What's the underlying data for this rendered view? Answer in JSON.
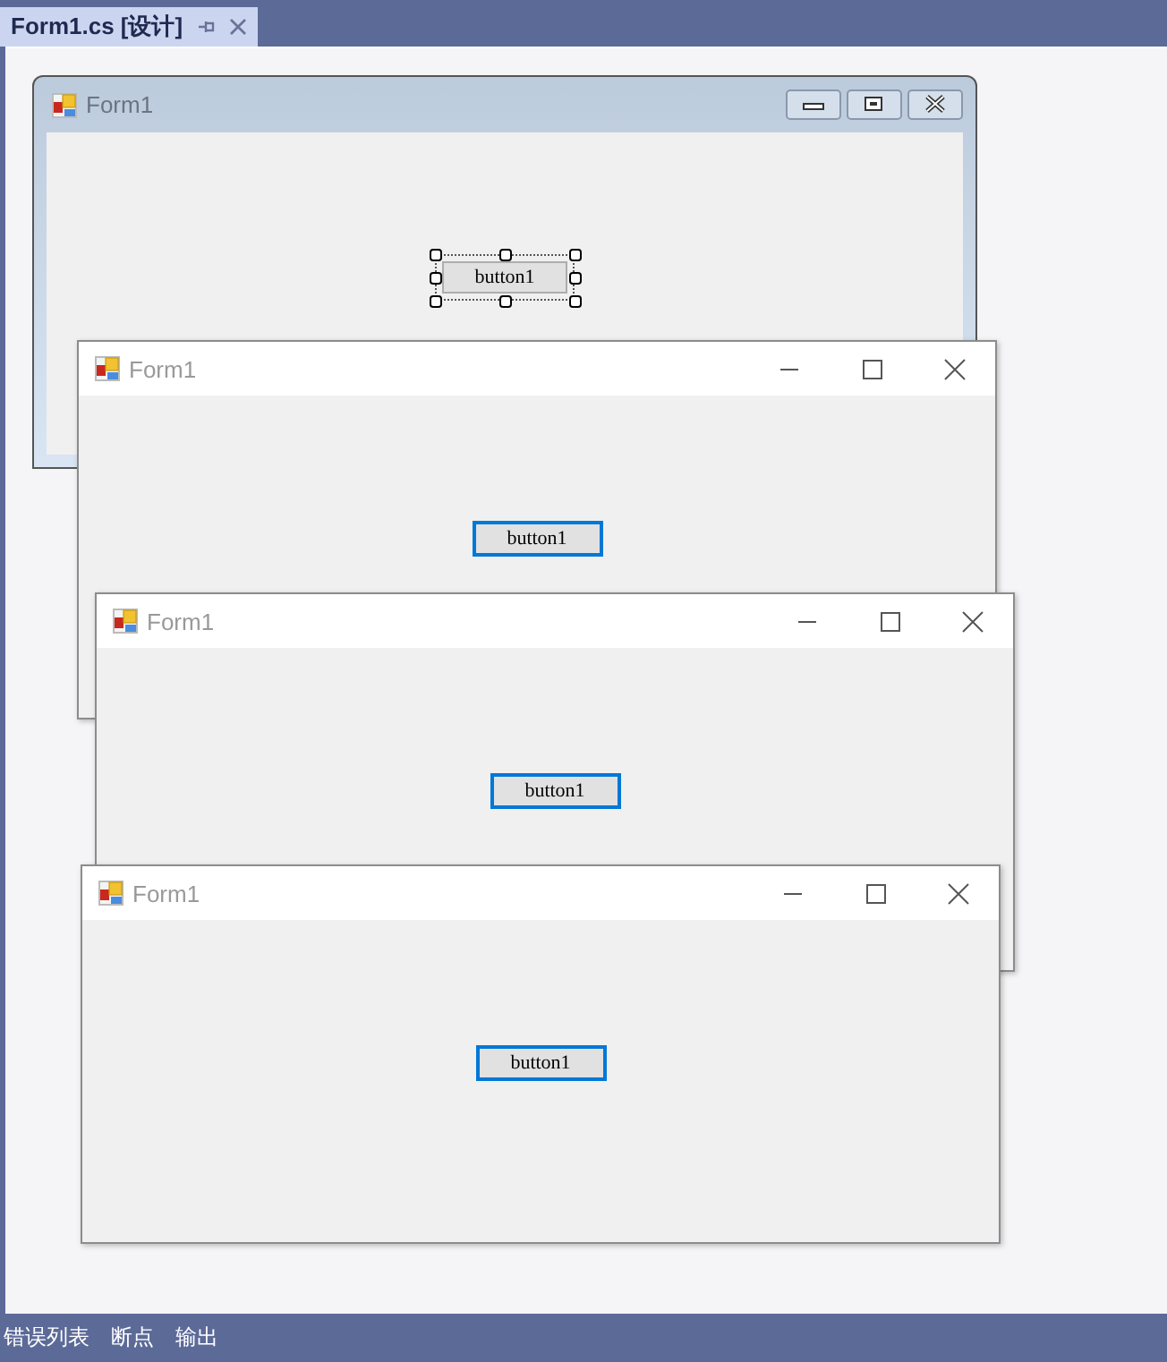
{
  "document_tab": {
    "label": "Form1.cs [设计]",
    "selected": true
  },
  "design_form": {
    "title": "Form1",
    "button": {
      "label": "button1",
      "selected": true
    }
  },
  "runtime_forms": [
    {
      "title": "Form1",
      "button": "button1"
    },
    {
      "title": "Form1",
      "button": "button1"
    },
    {
      "title": "Form1",
      "button": "button1"
    }
  ],
  "bottom_tabs": [
    "错误列表",
    "断点",
    "输出"
  ]
}
